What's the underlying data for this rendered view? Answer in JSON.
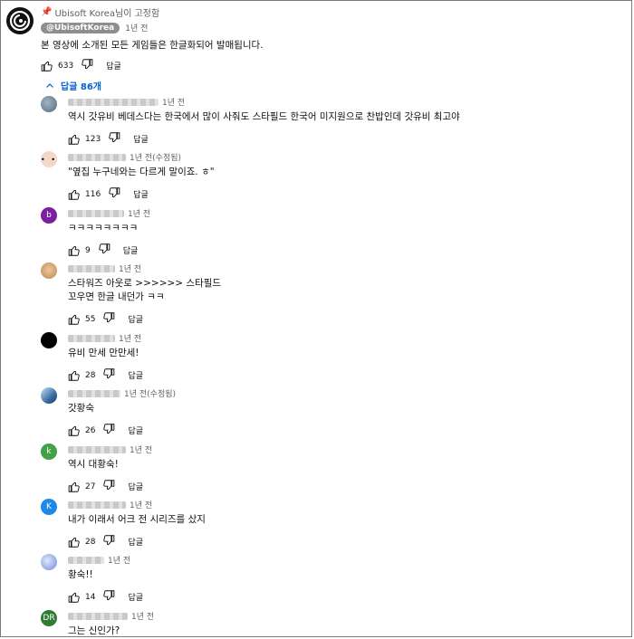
{
  "pinned": {
    "label": "Ubisoft Korea님이 고정함",
    "channel": "@UbisoftKorea",
    "time": "1년 전",
    "text": "본 영상에 소개된 모든 게임들은 한글화되어 발매됩니다.",
    "likes": "633",
    "reply_label": "답글"
  },
  "replies_toggle": "답글 86개",
  "replies": [
    {
      "avatar": "photo",
      "avatar_letter": "",
      "time": "1년 전",
      "text": "역시 갓유비 베데스다는 한국에서 많이 사줘도 스타필드 한국어 미지원으로 찬밥인데 갓유비 최고야",
      "likes": "123",
      "reply": "답글"
    },
    {
      "avatar": "face",
      "avatar_letter": "",
      "time": "1년 전(수정됨)",
      "text": "\"옆집 누구네와는 다르게 말이죠. ㅎ\"",
      "likes": "116",
      "reply": "답글"
    },
    {
      "avatar": "letter",
      "avatar_letter": "b",
      "time": "1년 전",
      "text": "ㅋㅋㅋㅋㅋㅋㅋㅋ",
      "likes": "9",
      "reply": "답글"
    },
    {
      "avatar": "photo2",
      "avatar_letter": "",
      "time": "1년 전",
      "text": "스타워즈 아웃로 >>>>>> 스타필드\n꼬우면 한글 내던가 ㅋㅋ",
      "likes": "55",
      "reply": "답글"
    },
    {
      "avatar": "black",
      "avatar_letter": "",
      "time": "1년 전",
      "text": "유비 만세 만만세!",
      "likes": "28",
      "reply": "답글"
    },
    {
      "avatar": "photo3",
      "avatar_letter": "",
      "time": "1년 전(수정됨)",
      "text": "갓황숙",
      "likes": "26",
      "reply": "답글"
    },
    {
      "avatar": "letter",
      "avatar_letter": "k",
      "time": "1년 전",
      "text": "역시 대황숙!",
      "likes": "27",
      "reply": "답글"
    },
    {
      "avatar": "letter",
      "avatar_letter": "K",
      "time": "1년 전",
      "text": "내가 이래서 어크 전 시리즈를 샀지",
      "likes": "28",
      "reply": "답글"
    },
    {
      "avatar": "photo4",
      "avatar_letter": "",
      "time": "1년 전",
      "text": "황숙!!",
      "likes": "14",
      "reply": "답글"
    },
    {
      "avatar": "letter",
      "avatar_letter": "DR",
      "time": "1년 전",
      "text": "그는 신인가?",
      "likes": "",
      "reply": ""
    }
  ],
  "colors": {
    "link_blue": "#065fd4",
    "avatar_b": "#7b1fa2",
    "avatar_k": "#43a047",
    "avatar_K": "#1e88e5",
    "avatar_DR": "#2e7d32"
  }
}
